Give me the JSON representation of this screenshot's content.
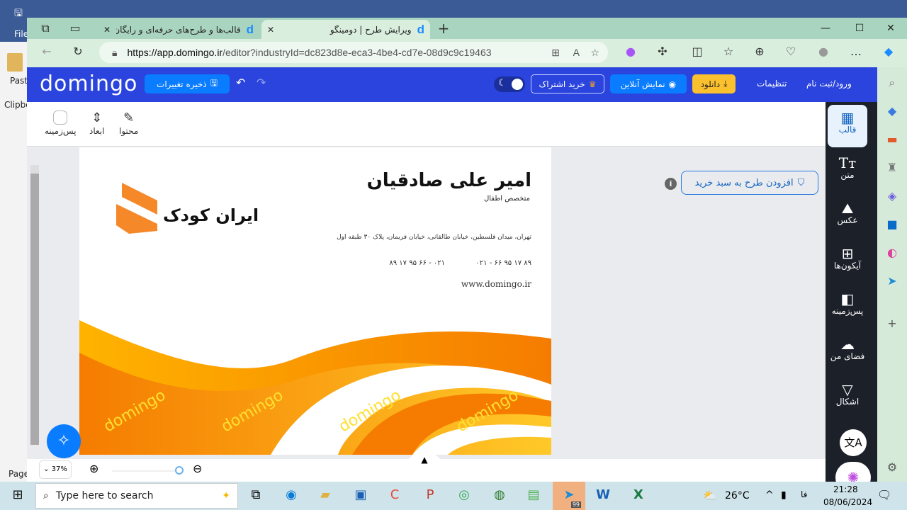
{
  "word": {
    "file": "File",
    "paste": "Paste",
    "clipboard": "Clipbo",
    "page": "Page"
  },
  "browser": {
    "tabs": [
      {
        "title": "قالب‌ها و طرح‌های حرفه‌ای و رایگان",
        "active": false
      },
      {
        "title": "ویرایش طرح | دومینگو",
        "active": true
      }
    ],
    "tab_icon": "d",
    "new_tab": "+",
    "url_host": "https://app.domingo.ir",
    "url_path": "/editor?industryId=dc823d8e-eca3-4be4-cd7e-08d9c9c19463"
  },
  "header": {
    "logo": "domingo",
    "save": "ذخیره تغییرات",
    "login": "ورود/ثبت نام",
    "settings": "تنظیمات",
    "download": "دانلود",
    "preview": "نمایش آنلاین",
    "subscribe": "خرید اشتراک",
    "colors": {
      "header": "#2a44dd",
      "download": "#fbc02d",
      "preview": "#0a7cff"
    }
  },
  "toolbar": {
    "content": "محتوا",
    "dimensions": "ابعاد",
    "background": "پس‌زمینه"
  },
  "right_sidebar": [
    {
      "label": "قالب",
      "icon": "template-icon",
      "active": true
    },
    {
      "label": "متن",
      "icon": "text-icon"
    },
    {
      "label": "عکس",
      "icon": "image-icon"
    },
    {
      "label": "آیکون‌ها",
      "icon": "grid-icon"
    },
    {
      "label": "پس‌زمینه",
      "icon": "background-icon"
    },
    {
      "label": "فضای من",
      "icon": "cloud-upload-icon"
    },
    {
      "label": "اشکال",
      "icon": "shapes-icon"
    }
  ],
  "add_to_cart": "افزودن طرح به سبد خرید",
  "card": {
    "name": "امیر علی صادقیان",
    "title": "متخصص اطفال",
    "company": "ایران کودک",
    "address": "تهران، میدان فلسطین، خیابان طالقانی، خیابان فریمان، پلاک ۳۰ طبقه اول",
    "phone1": "۰۲۱ - ۶۶ ۹۵ ۱۷ ۸۹",
    "phone2": "۰۲۱ - ۶۶ ۹۵ ۱۷ ۸۹",
    "website": "www.domingo.ir",
    "watermark": "domingo"
  },
  "zoom": {
    "value": "37%",
    "slider_fraction": 1.0
  },
  "taskbar": {
    "search_placeholder": "Type here to search",
    "temperature": "26°C",
    "lang": "فا",
    "time": "21:28",
    "date": "08/06/2024",
    "telegram_badge": "99"
  }
}
